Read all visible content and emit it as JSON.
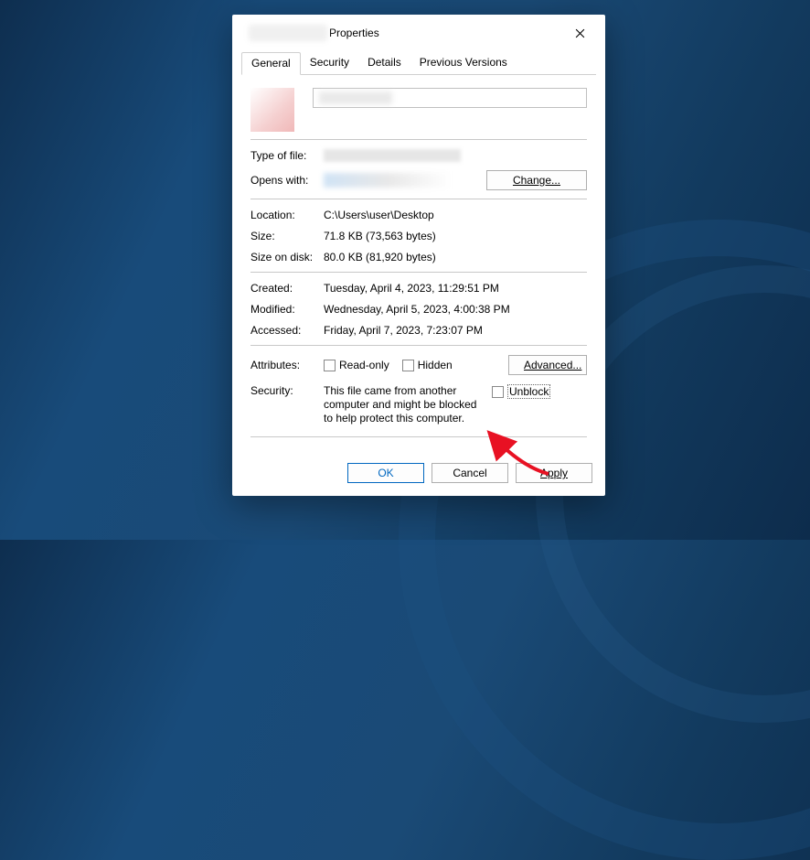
{
  "title": "Properties",
  "tabs": [
    {
      "label": "General",
      "active": true
    },
    {
      "label": "Security"
    },
    {
      "label": "Details"
    },
    {
      "label": "Previous Versions"
    }
  ],
  "fields": {
    "type_of_file_label": "Type of file:",
    "opens_with_label": "Opens with:",
    "change_btn": "Change...",
    "location_label": "Location:",
    "location_value": "C:\\Users\\user\\Desktop",
    "size_label": "Size:",
    "size_value": "71.8 KB (73,563 bytes)",
    "size_on_disk_label": "Size on disk:",
    "size_on_disk_value": "80.0 KB (81,920 bytes)",
    "created_label": "Created:",
    "created_value": "Tuesday, April 4, 2023, 11:29:51 PM",
    "modified_label": "Modified:",
    "modified_value": "Wednesday, April 5, 2023, 4:00:38 PM",
    "accessed_label": "Accessed:",
    "accessed_value": "Friday, April 7, 2023, 7:23:07 PM",
    "attributes_label": "Attributes:",
    "readonly_label": "Read-only",
    "hidden_label": "Hidden",
    "advanced_btn": "Advanced...",
    "security_label": "Security:",
    "security_text": "This file came from another computer and might be blocked to help protect this computer.",
    "unblock_label": "Unblock"
  },
  "footer": {
    "ok": "OK",
    "cancel": "Cancel",
    "apply": "Apply"
  }
}
